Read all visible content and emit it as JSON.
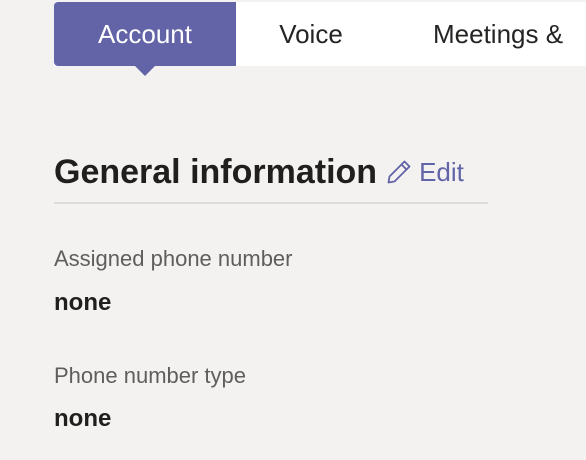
{
  "tabs": [
    {
      "label": "Account",
      "active": true
    },
    {
      "label": "Voice",
      "active": false
    },
    {
      "label": "Meetings &",
      "active": false
    }
  ],
  "section": {
    "title": "General information",
    "edit_label": "Edit",
    "edit_icon": "pencil-icon"
  },
  "fields": [
    {
      "label": "Assigned phone number",
      "value": "none"
    },
    {
      "label": "Phone number type",
      "value": "none"
    }
  ],
  "colors": {
    "accent": "#6264a7",
    "background": "#f3f2f1",
    "tabbar": "#ffffff"
  }
}
